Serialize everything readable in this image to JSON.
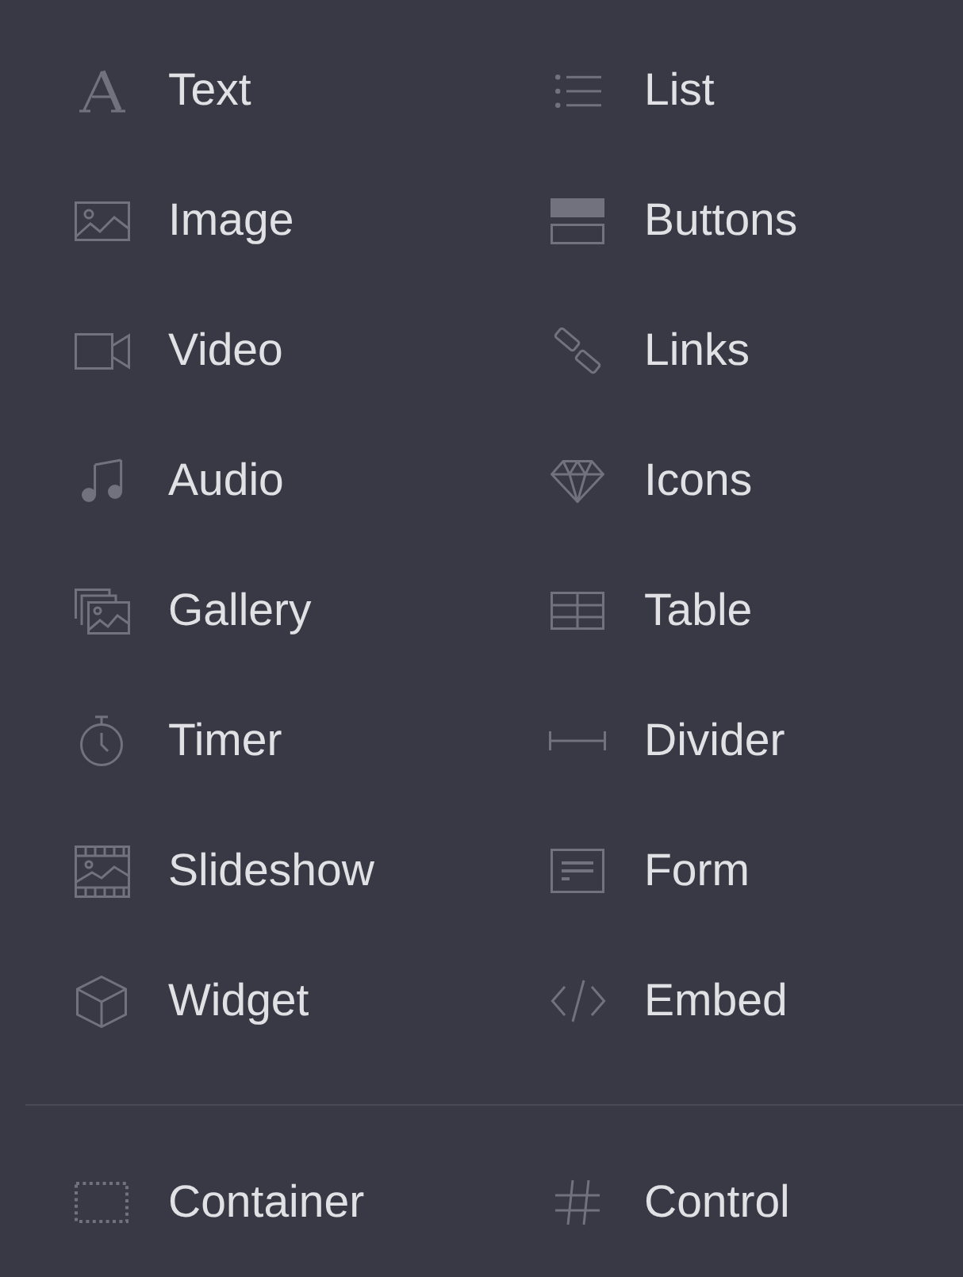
{
  "elements": [
    {
      "kind": "text",
      "label": "Text"
    },
    {
      "kind": "list",
      "label": "List"
    },
    {
      "kind": "image",
      "label": "Image"
    },
    {
      "kind": "buttons",
      "label": "Buttons"
    },
    {
      "kind": "video",
      "label": "Video"
    },
    {
      "kind": "links",
      "label": "Links"
    },
    {
      "kind": "audio",
      "label": "Audio"
    },
    {
      "kind": "icons",
      "label": "Icons"
    },
    {
      "kind": "gallery",
      "label": "Gallery"
    },
    {
      "kind": "table",
      "label": "Table"
    },
    {
      "kind": "timer",
      "label": "Timer"
    },
    {
      "kind": "divider",
      "label": "Divider"
    },
    {
      "kind": "slideshow",
      "label": "Slideshow"
    },
    {
      "kind": "form",
      "label": "Form"
    },
    {
      "kind": "widget",
      "label": "Widget"
    },
    {
      "kind": "embed",
      "label": "Embed"
    }
  ],
  "layout_elements": [
    {
      "kind": "container",
      "label": "Container"
    },
    {
      "kind": "control",
      "label": "Control"
    }
  ]
}
